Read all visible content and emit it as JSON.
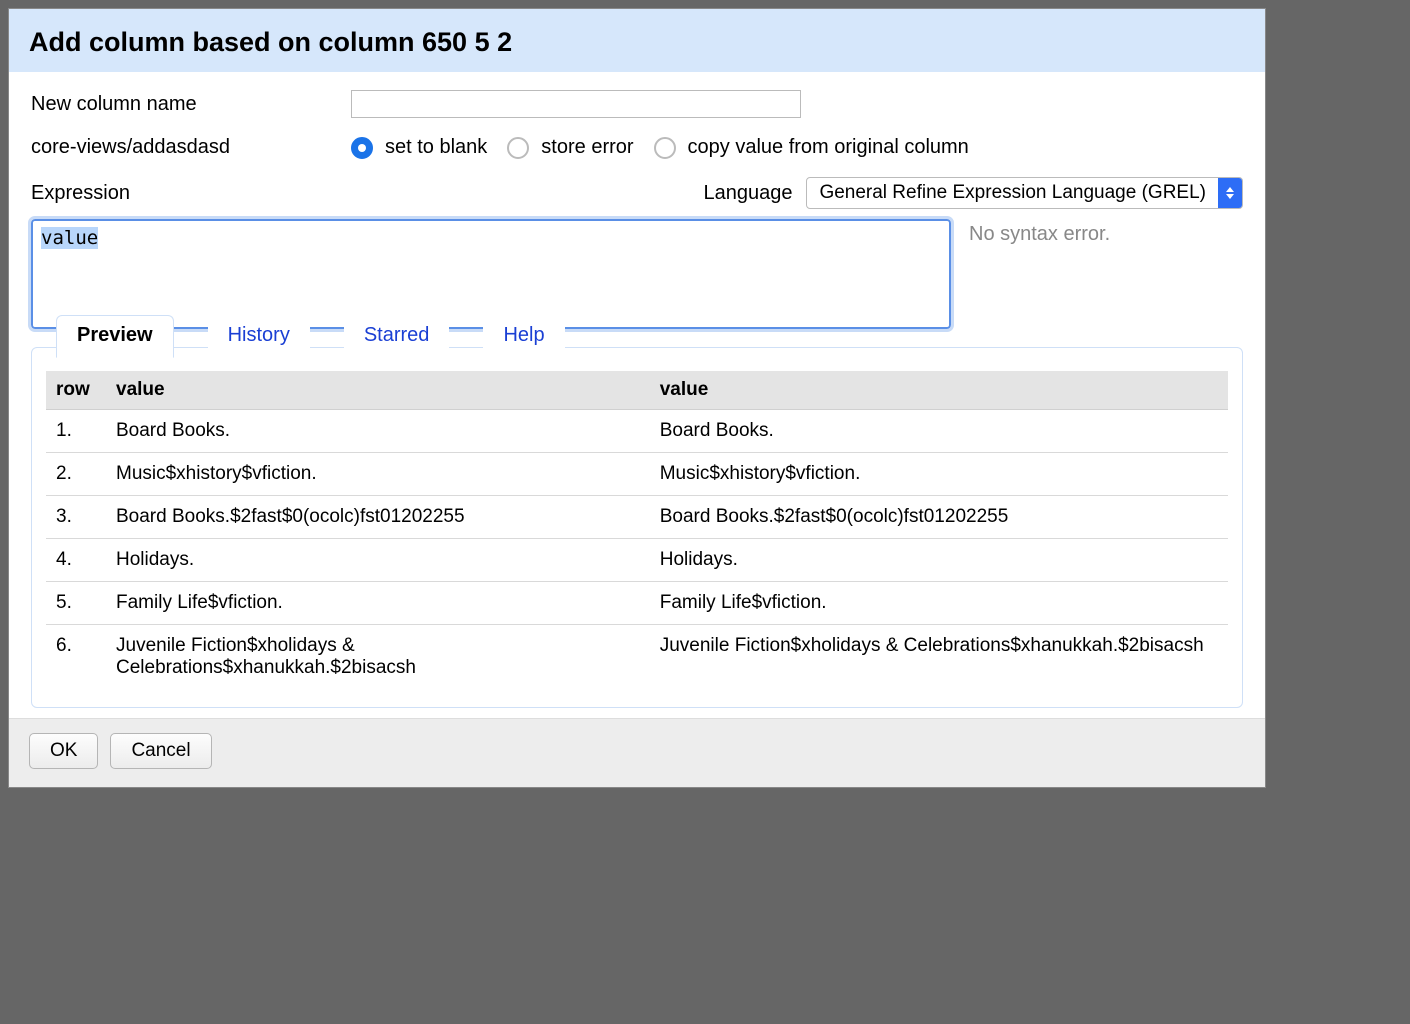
{
  "dialog": {
    "title": "Add column based on column 650 5 2"
  },
  "form": {
    "new_column_label": "New column name",
    "new_column_value": "",
    "on_error_label": "core-views/addasdasd",
    "radios": {
      "blank": "set to blank",
      "store_error": "store error",
      "copy_value": "copy value from original column"
    },
    "expression_label": "Expression",
    "language_label": "Language",
    "language_value": "General Refine Expression Language (GREL)",
    "expression_value": "value",
    "syntax_msg": "No syntax error."
  },
  "tabs": {
    "preview": "Preview",
    "history": "History",
    "starred": "Starred",
    "help": "Help"
  },
  "preview": {
    "headers": {
      "row": "row",
      "value1": "value",
      "value2": "value"
    },
    "rows": [
      {
        "n": "1.",
        "v1": "Board Books.",
        "v2": "Board Books."
      },
      {
        "n": "2.",
        "v1": "Music$xhistory$vfiction.",
        "v2": "Music$xhistory$vfiction."
      },
      {
        "n": "3.",
        "v1": "Board Books.$2fast$0(ocolc)fst01202255",
        "v2": "Board Books.$2fast$0(ocolc)fst01202255"
      },
      {
        "n": "4.",
        "v1": "Holidays.",
        "v2": "Holidays."
      },
      {
        "n": "5.",
        "v1": "Family Life$vfiction.",
        "v2": "Family Life$vfiction."
      },
      {
        "n": "6.",
        "v1": "Juvenile Fiction$xholidays & Celebrations$xhanukkah.$2bisacsh",
        "v2": "Juvenile Fiction$xholidays & Celebrations$xhanukkah.$2bisacsh"
      }
    ]
  },
  "buttons": {
    "ok": "OK",
    "cancel": "Cancel"
  }
}
